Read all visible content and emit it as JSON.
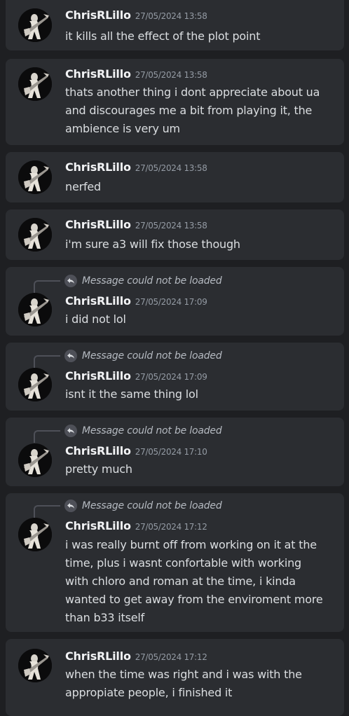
{
  "author": "ChrisRLillo",
  "reply_preview": "Message could not be loaded",
  "messages": [
    {
      "time": "27/05/2024 13:58",
      "text": "it kills all the effect of the plot point"
    },
    {
      "time": "27/05/2024 13:58",
      "text": "thats another thing i dont appreciate about ua and discourages me a bit from playing it, the ambience is very um"
    },
    {
      "time": "27/05/2024 13:58",
      "text": "nerfed"
    },
    {
      "time": "27/05/2024 13:58",
      "text": "i'm sure a3 will fix those though"
    },
    {
      "time": "27/05/2024 17:09",
      "text": "i did not lol"
    },
    {
      "time": "27/05/2024 17:09",
      "text": "isnt it the same thing lol"
    },
    {
      "time": "27/05/2024 17:10",
      "text": "pretty much"
    },
    {
      "time": "27/05/2024 17:12",
      "text": "i was really burnt off from working on it at the time, plus i wasnt confortable with working with chloro and roman at the time, i kinda wanted to get away from the enviroment more than b33 itself"
    },
    {
      "time": "27/05/2024 17:12",
      "text": "when the time was right and i was with the appropiate people, i finished it"
    }
  ]
}
